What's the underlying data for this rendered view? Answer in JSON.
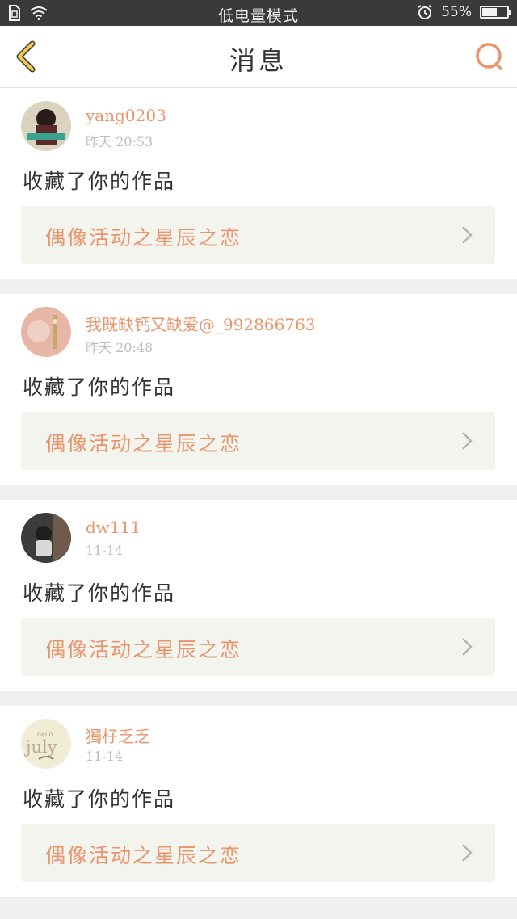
{
  "status_bar": {
    "center_text": "低电量模式",
    "battery_percent_text": "55%",
    "battery_level": 0.55
  },
  "nav": {
    "title": "消息"
  },
  "messages": [
    {
      "username": "yang0203",
      "time": "昨天 20:53",
      "action": "收藏了你的作品",
      "work_title": "偶像活动之星辰之恋"
    },
    {
      "username": "我既缺钙又缺爱@_992866763",
      "time": "昨天 20:48",
      "action": "收藏了你的作品",
      "work_title": "偶像活动之星辰之恋"
    },
    {
      "username": "dw111",
      "time": "11-14",
      "action": "收藏了你的作品",
      "work_title": "偶像活动之星辰之恋"
    },
    {
      "username": "獨杍乏乏",
      "time": "11-14",
      "action": "收藏了你的作品",
      "work_title": "偶像活动之星辰之恋"
    }
  ],
  "avatar_4_text": {
    "small": "hello",
    "big": "july"
  },
  "colors": {
    "accent": "#e9956b",
    "back_icon": "#f3c94a",
    "card_link_bg": "#f4f4ef"
  },
  "icons": [
    "sim-icon",
    "wifi-icon",
    "alarm-icon",
    "battery-icon",
    "back-arrow-icon",
    "search-icon",
    "chevron-right-icon"
  ]
}
